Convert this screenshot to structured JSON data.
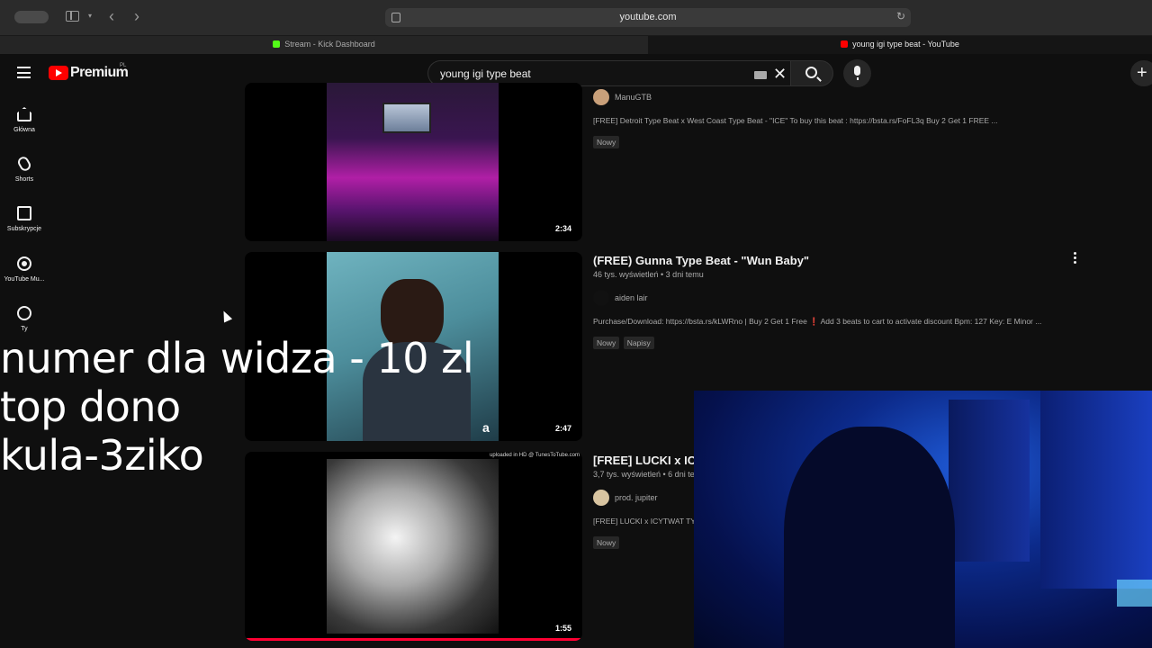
{
  "browser": {
    "address": "youtube.com",
    "tabs": [
      {
        "label": "Stream - Kick Dashboard"
      },
      {
        "label": "young igi type beat - YouTube"
      }
    ]
  },
  "header": {
    "brand": "Premium",
    "country": "PL",
    "search_value": "young igi type beat"
  },
  "guide": [
    {
      "label": "Główna",
      "icon": "home-icon"
    },
    {
      "label": "Shorts",
      "icon": "shorts-icon"
    },
    {
      "label": "Subskrypcje",
      "icon": "subscriptions-icon"
    },
    {
      "label": "YouTube Mu...",
      "icon": "youtube-music-icon"
    },
    {
      "label": "Ty",
      "icon": "you-icon"
    }
  ],
  "results": [
    {
      "duration": "2:34",
      "channel": "ManuGTB",
      "description": "[FREE] Detroit Type Beat x West Coast Type Beat - \"ICE\" To buy this beat : https://bsta.rs/FoFL3q Buy 2 Get 1 FREE ...",
      "badges": [
        "Nowy"
      ]
    },
    {
      "duration": "2:47",
      "title": "(FREE) Gunna Type Beat - \"Wun Baby\"",
      "meta": "46 tys. wyświetleń • 3 dni temu",
      "channel": "aiden lair",
      "thumb_watermark": "a",
      "description": "Purchase/Download: https://bsta.rs/kLWRno | Buy 2 Get 1 Free  ❗ Add 3 beats to cart to activate discount Bpm: 127 Key: E Minor ...",
      "badges": [
        "Nowy",
        "Napisy"
      ]
    },
    {
      "duration": "1:55",
      "title": "[FREE] LUCKI x ICY",
      "meta": "3,7 tys. wyświetleń • 6 dni te",
      "channel": "prod. jupiter",
      "thumb_caption": "uploaded in HD @ TunesToTube.com",
      "description": "[FREE] LUCKI x ICYTWAT TY",
      "badges": [
        "Nowy"
      ]
    }
  ],
  "overlay": {
    "lines": [
      "numer dla widza - 10 zl",
      "top dono",
      "kula-3ziko"
    ]
  }
}
